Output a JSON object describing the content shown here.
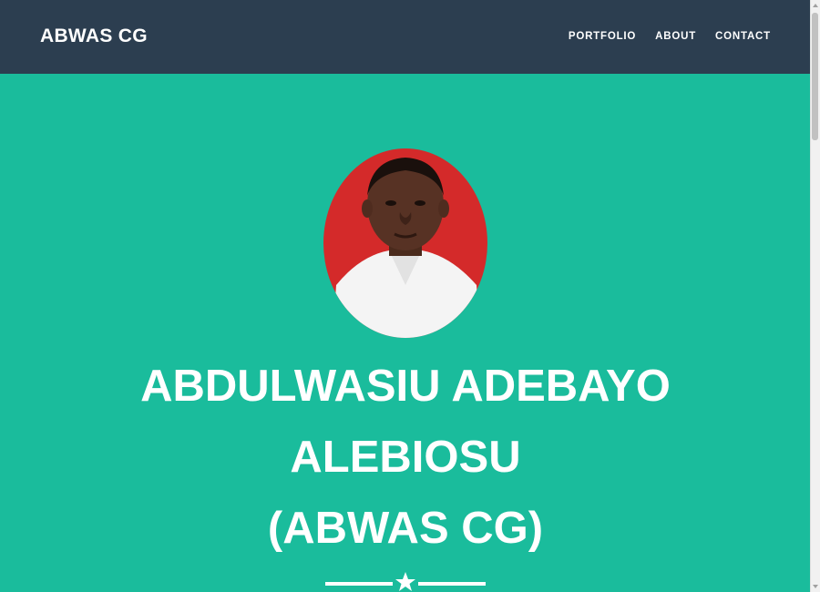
{
  "navbar": {
    "brand": "ABWAS CG",
    "links": [
      {
        "label": "PORTFOLIO"
      },
      {
        "label": "ABOUT"
      },
      {
        "label": "CONTACT"
      }
    ]
  },
  "hero": {
    "name_line1": "ABDULWASIU ADEBAYO",
    "name_line2": "ALEBIOSU",
    "name_line3": "(ABWAS CG)",
    "divider_icon": "star-icon"
  },
  "colors": {
    "navbar_bg": "#2c3e50",
    "hero_bg": "#1abc9c",
    "text": "#ffffff",
    "avatar_bg": "#d42a2a"
  },
  "scrollbar": {
    "position": 0.0
  }
}
